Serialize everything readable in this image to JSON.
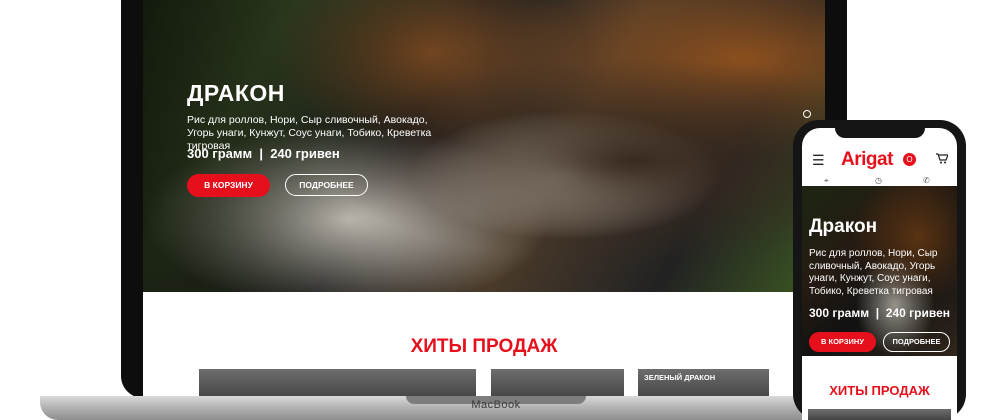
{
  "laptop": {
    "brand": "MacBook",
    "hero": {
      "title": "ДРАКОН",
      "description": "Рис для роллов, Нори, Сыр сливочный, Авокадо, Угорь унаги, Кунжут, Соус унаги, Тобико, Креветка тигровая",
      "meta": "300 грамм  |  240 гривен",
      "cart_button": "В КОРЗИНУ",
      "more_button": "ПОДРОБНЕЕ"
    },
    "section_title": "ХИТЫ ПРОДАЖ",
    "cards": [
      {
        "label": ""
      },
      {
        "label": ""
      },
      {
        "label": "ЗЕЛЕНЫЙ ДРАКОН"
      }
    ]
  },
  "phone": {
    "logo": "Arigat",
    "logo_mark": "O",
    "hero": {
      "title": "Дракон",
      "description": "Рис для роллов, Нори, Сыр сливочный, Авокадо, Угорь унаги, Кунжут, Соус унаги, Тобико, Креветка тигровая",
      "meta": "300 грамм  |  240 гривен",
      "cart_button": "В КОРЗИНУ",
      "more_button": "ПОДРОБНЕЕ"
    },
    "section_title": "ХИТЫ ПРОДАЖ"
  },
  "icons": {
    "menu": "menu-icon",
    "cart": "cart-icon",
    "location": "location-icon",
    "clock": "clock-icon",
    "phone": "phone-icon"
  },
  "colors": {
    "accent": "#e6101c"
  }
}
